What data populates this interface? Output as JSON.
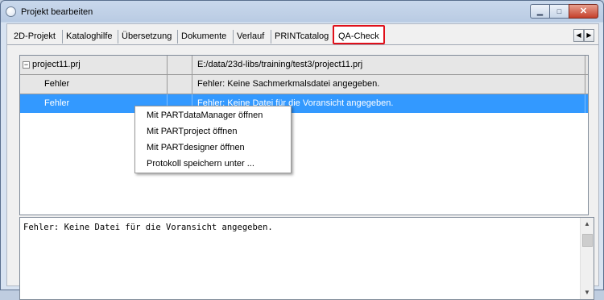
{
  "window": {
    "title": "Projekt bearbeiten",
    "controls": {
      "minimize": "▁",
      "maximize": "□",
      "close": "✕"
    }
  },
  "tabs": [
    {
      "label": "2D-Projekt"
    },
    {
      "label": "Kataloghilfe"
    },
    {
      "label": "Übersetzung"
    },
    {
      "label": "Dokumente"
    },
    {
      "label": "Verlauf"
    },
    {
      "label": "PRINTcatalog"
    },
    {
      "label": "QA-Check",
      "active": true
    }
  ],
  "tab_scroll": {
    "left": "◀",
    "right": "▶"
  },
  "grid": {
    "rows": [
      {
        "name": "project11.prj",
        "col2": "",
        "detail": "E:/data/23d-libs/training/test3/project11.prj",
        "expander": "−"
      },
      {
        "name": "Fehler",
        "col2": "",
        "detail": "Fehler: Keine Sachmerkmalsdatei angegeben."
      },
      {
        "name": "Fehler",
        "col2": "",
        "detail": "Fehler: Keine Datei für die Voransicht angegeben.",
        "selected": true
      }
    ]
  },
  "context_menu": {
    "items": [
      "Mit PARTdataManager öffnen",
      "Mit PARTproject öffnen",
      "Mit PARTdesigner öffnen",
      "Protokoll speichern unter ..."
    ]
  },
  "output": {
    "text": "Fehler: Keine Datei für die Voransicht angegeben.",
    "scroll_up": "▲",
    "scroll_down": "▼"
  },
  "colors": {
    "selection": "#3399ff",
    "active_tab_border": "#e0101a",
    "close_button": "#c5402b"
  }
}
